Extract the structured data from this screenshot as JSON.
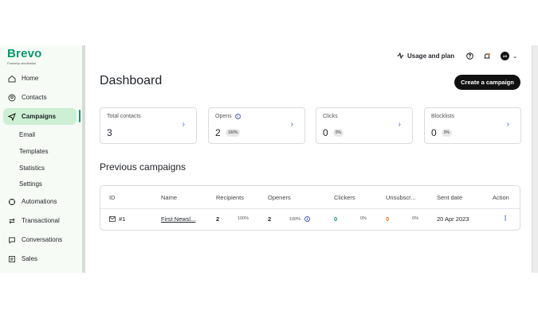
{
  "brand": {
    "name": "Brevo",
    "subtitle": "Formerly sendinblue"
  },
  "colors": {
    "accent": "#0b996e",
    "active_bg": "#cdefd3",
    "link_blue": "#3b5bdb",
    "orange": "#e8711a"
  },
  "sidebar": {
    "items": [
      {
        "label": "Home",
        "icon": "home-icon"
      },
      {
        "label": "Contacts",
        "icon": "contacts-icon"
      },
      {
        "label": "Campaigns",
        "icon": "send-icon",
        "active": true
      },
      {
        "label": "Automations",
        "icon": "automations-icon"
      },
      {
        "label": "Transactional",
        "icon": "transactional-icon"
      },
      {
        "label": "Conversations",
        "icon": "chat-icon"
      },
      {
        "label": "Sales",
        "icon": "sales-icon"
      }
    ],
    "campaign_sub": [
      "Email",
      "Templates",
      "Statistics",
      "Settings"
    ]
  },
  "topbar": {
    "usage_label": "Usage and plan",
    "avatar_initials": "AS"
  },
  "page": {
    "title": "Dashboard",
    "create_button": "Create a campaign"
  },
  "stats": [
    {
      "label": "Total contacts",
      "value": "3"
    },
    {
      "label": "Opens",
      "value": "2",
      "badge": "100%",
      "info": true
    },
    {
      "label": "Clicks",
      "value": "0",
      "badge": "0%"
    },
    {
      "label": "Blocklists",
      "value": "0",
      "badge": "0%"
    }
  ],
  "campaigns": {
    "title": "Previous campaigns",
    "columns": [
      "ID",
      "Name",
      "Recipients",
      "Openers",
      "Clickers",
      "Unsubscr...",
      "Sent date",
      "Action"
    ],
    "rows": [
      {
        "id": "#1",
        "name": "First Newsl...",
        "recipients": "2",
        "recipients_pct": "100%",
        "openers": "2",
        "openers_pct": "100%",
        "clickers": "0",
        "clickers_pct": "0%",
        "unsubs": "0",
        "unsubs_pct": "0%",
        "sent_date": "20 Apr 2023"
      }
    ]
  }
}
